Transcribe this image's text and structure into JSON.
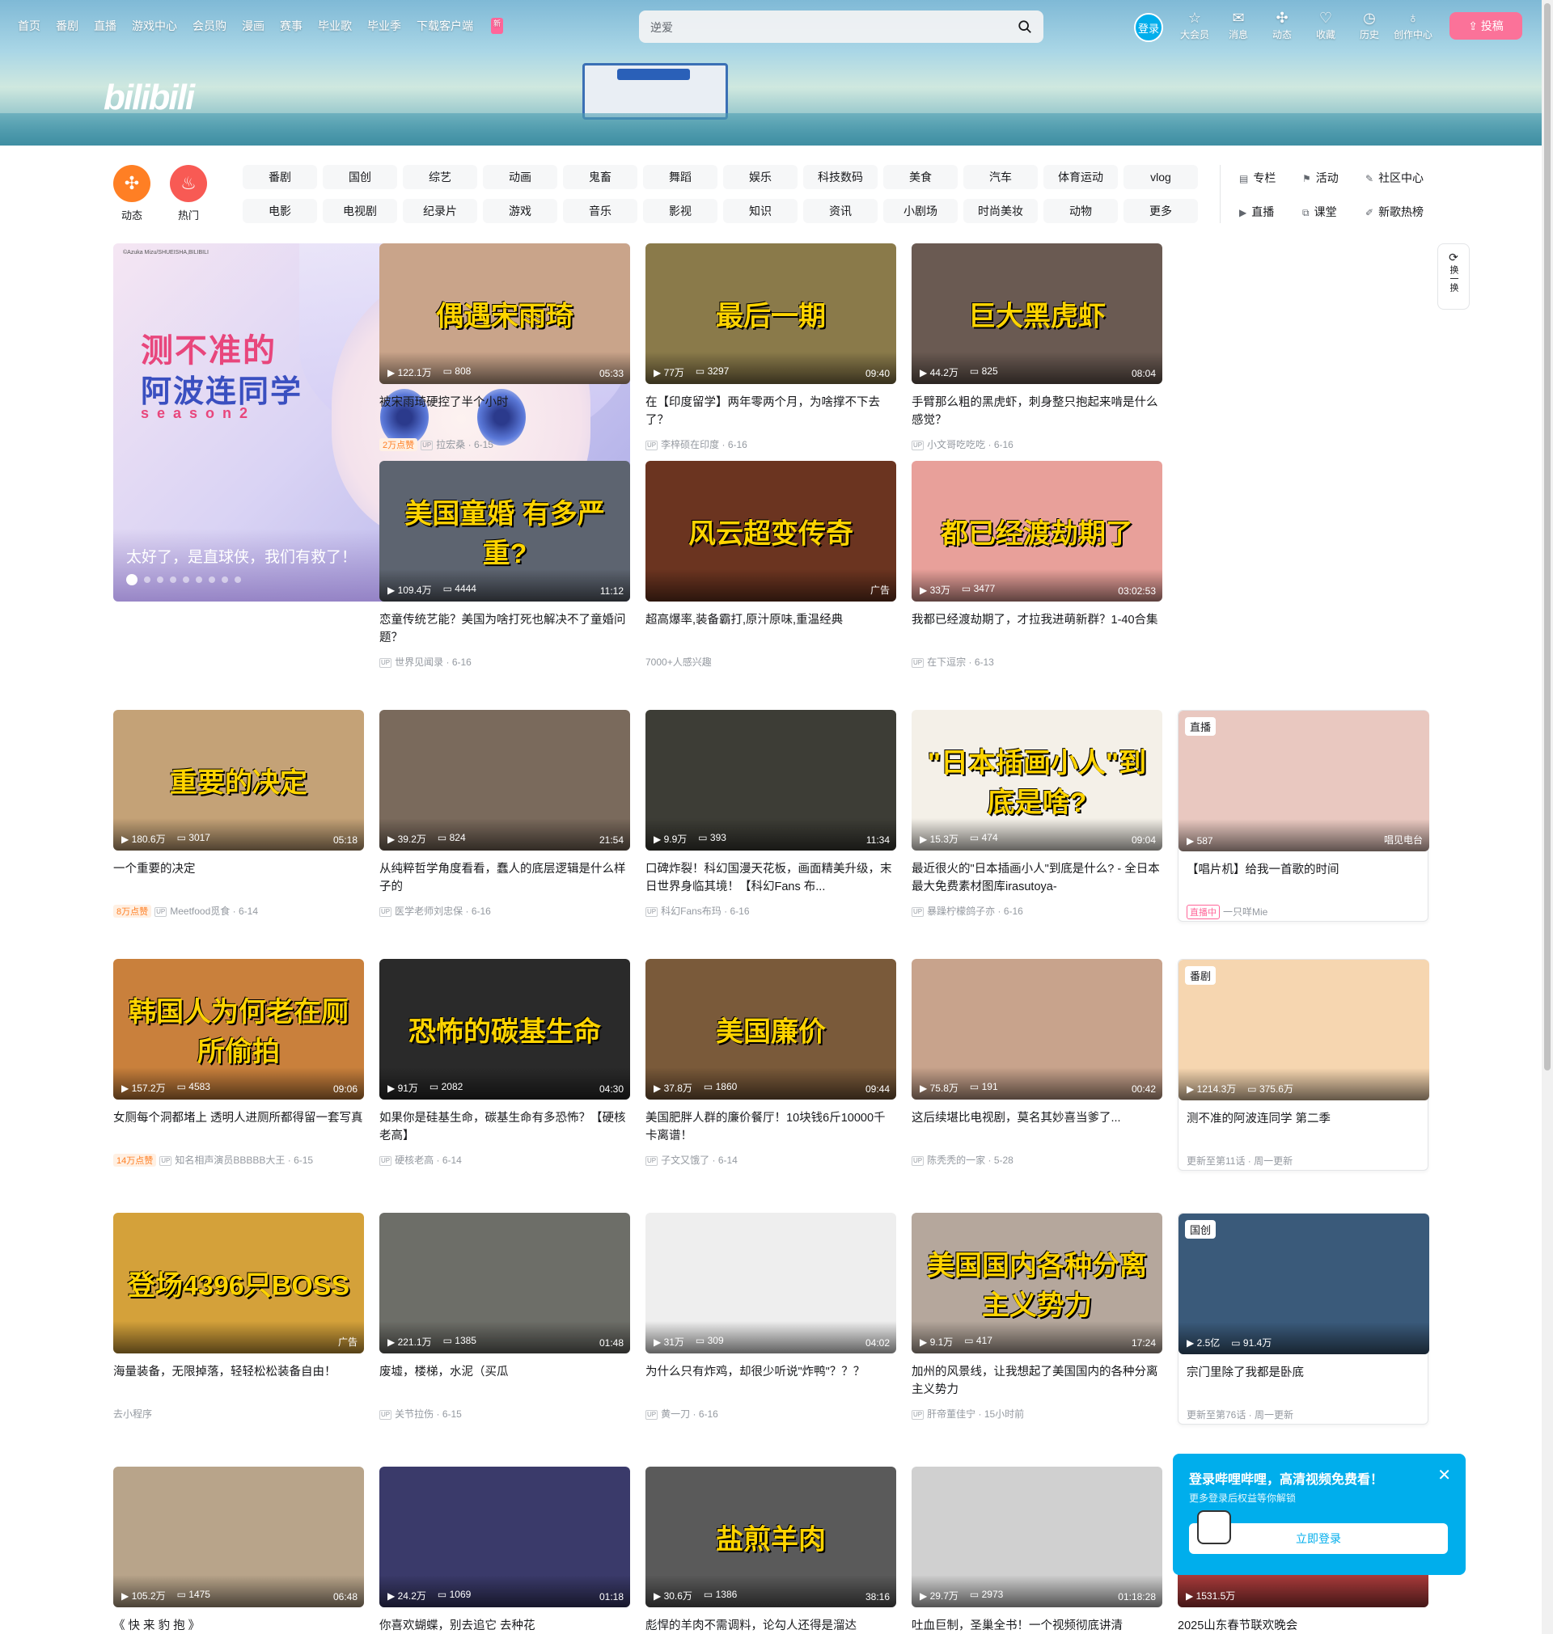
{
  "topnav": {
    "items": [
      "首页",
      "番剧",
      "直播",
      "游戏中心",
      "会员购",
      "漫画",
      "赛事",
      "毕业歌",
      "毕业季",
      "下载客户端"
    ],
    "new_badge": "新",
    "search_placeholder": "逆爱",
    "login": "登录",
    "icons": [
      {
        "label": "大会员",
        "icon": "vip-icon"
      },
      {
        "label": "消息",
        "icon": "message-icon"
      },
      {
        "label": "动态",
        "icon": "dynamic-icon"
      },
      {
        "label": "收藏",
        "icon": "favorite-icon"
      },
      {
        "label": "历史",
        "icon": "history-icon"
      },
      {
        "label": "创作中心",
        "icon": "creator-icon"
      }
    ],
    "upload": "投稿"
  },
  "banner": {
    "logo": "bilibili"
  },
  "channels": {
    "round": [
      {
        "label": "动态",
        "color": "#ff7f24"
      },
      {
        "label": "热门",
        "color": "#f85a54"
      }
    ],
    "grid": [
      "番剧",
      "国创",
      "综艺",
      "动画",
      "鬼畜",
      "舞蹈",
      "娱乐",
      "科技数码",
      "美食",
      "汽车",
      "体育运动",
      "vlog",
      "电影",
      "电视剧",
      "纪录片",
      "游戏",
      "音乐",
      "影视",
      "知识",
      "资讯",
      "小剧场",
      "时尚美妆",
      "动物",
      "更多"
    ],
    "side": [
      "专栏",
      "活动",
      "社区中心",
      "直播",
      "课堂",
      "新歌热榜"
    ]
  },
  "carousel": {
    "credit": "©Azuka Mizu/SHUEISHA,BILIBILI",
    "title_line1": "测不准的",
    "title_line2": "阿波连同学",
    "title_line3": "season2",
    "caption": "太好了，是直球侠，我们有救了！"
  },
  "refresh": {
    "label": "换一换"
  },
  "cards": [
    {
      "thumb_text": "偶遇宋雨琦",
      "views": "122.1万",
      "danmaku": "808",
      "duration": "05:33",
      "title": "被宋雨琦硬控了半个小时",
      "hot": "2万点赞",
      "author": "拉宏桑",
      "date": "6-15",
      "bg": "#c9a48a"
    },
    {
      "thumb_text": "最后一期",
      "views": "77万",
      "danmaku": "3297",
      "duration": "09:40",
      "title": "在【印度留学】两年零两个月，为啥撑不下去了？",
      "author": "李梓硕在印度",
      "date": "6-16",
      "bg": "#8a7a4a"
    },
    {
      "thumb_text": "巨大黑虎虾",
      "views": "44.2万",
      "danmaku": "825",
      "duration": "08:04",
      "title": "手臂那么粗的黑虎虾，刺身整只抱起来啃是什么感觉？",
      "author": "小文哥吃吃吃",
      "date": "6-16",
      "bg": "#6a5a52"
    },
    {
      "thumb_text": "美国童婚 有多严重?",
      "views": "109.4万",
      "danmaku": "4444",
      "duration": "11:12",
      "title": "恋童传统艺能？美国为啥打死也解决不了童婚问题？",
      "author": "世界见闻录",
      "date": "6-16",
      "bg": "#5d6470"
    },
    {
      "thumb_text": "风云超变传奇",
      "views": "",
      "danmaku": "",
      "duration": "广告",
      "title": "超高爆率,装备霸打,原汁原味,重温经典",
      "author": "7000+人感兴趣",
      "date": "",
      "bg": "#6b3420",
      "ad": true
    },
    {
      "thumb_text": "都已经渡劫期了",
      "views": "33万",
      "danmaku": "3477",
      "duration": "03:02:53",
      "title": "我都已经渡劫期了，才拉我进萌新群？1-40合集",
      "author": "在下逗宗",
      "date": "6-13",
      "bg": "#e8a09a"
    },
    {
      "thumb_text": "重要的决定",
      "views": "180.6万",
      "danmaku": "3017",
      "duration": "05:18",
      "title": "一个重要的决定",
      "hot": "8万点赞",
      "author": "Meetfood觅食",
      "date": "6-14",
      "bg": "#c4a277"
    },
    {
      "thumb_text": "",
      "views": "39.2万",
      "danmaku": "824",
      "duration": "21:54",
      "title": "从纯粹哲学角度看看，蠢人的底层逻辑是什么样子的",
      "author": "医学老师刘忠保",
      "date": "6-16",
      "bg": "#7a6a5c"
    },
    {
      "thumb_text": "",
      "views": "9.9万",
      "danmaku": "393",
      "duration": "11:34",
      "title": "口碑炸裂！科幻国漫天花板，画面精美升级，末日世界身临其境！【科幻Fans 布...",
      "author": "科幻Fans布玛",
      "date": "6-16",
      "bg": "#3d3d36"
    },
    {
      "thumb_text": "\"日本插画小人\"到底是啥?",
      "views": "15.3万",
      "danmaku": "474",
      "duration": "09:04",
      "title": "最近很火的\"日本插画小人\"到底是什么? - 全日本最大免费素材图库irasutoya-",
      "author": "暴躁柠檬鸽子亦",
      "date": "6-16",
      "bg": "#f4f0e8"
    },
    {
      "thumb_text": "",
      "live_tag": "直播",
      "views": "587",
      "danmaku": "",
      "duration": "唱见电台",
      "title": "【唱片机】给我一首歌的时间",
      "live_badge": "直播中",
      "author": "一只咩Mie",
      "date": "",
      "bg": "#e9c8c0",
      "framed": true
    },
    {
      "thumb_text": "韩国人为何老在厕所偷拍",
      "views": "157.2万",
      "danmaku": "4583",
      "duration": "09:06",
      "title": "女厕每个洞都堵上 透明人进厕所都得留一套写真",
      "hot": "14万点赞",
      "author": "知名相声演员BBBBB大王",
      "date": "6-15",
      "bg": "#c9803c"
    },
    {
      "thumb_text": "恐怖的碳基生命",
      "views": "91万",
      "danmaku": "2082",
      "duration": "04:30",
      "title": "如果你是硅基生命，碳基生命有多恐怖？【硬核老高】",
      "author": "硬核老高",
      "date": "6-14",
      "bg": "#2a2a2a"
    },
    {
      "thumb_text": "美国廉价",
      "views": "37.8万",
      "danmaku": "1860",
      "duration": "09:44",
      "title": "美国肥胖人群的廉价餐厅！10块钱6斤10000千卡离谱！",
      "author": "子文又饿了",
      "date": "6-14",
      "bg": "#7a5a3a"
    },
    {
      "thumb_text": "",
      "views": "75.8万",
      "danmaku": "191",
      "duration": "00:42",
      "title": "这后续堪比电视剧，莫名其妙喜当爹了...",
      "author": "陈秃秃的一家",
      "date": "5-28",
      "bg": "#c8a38c"
    },
    {
      "thumb_text": "",
      "anime_tag": "番剧",
      "views": "1214.3万",
      "danmaku": "375.6万",
      "duration": "",
      "title": "测不准的阿波连同学 第二季",
      "author": "更新至第11话 · 周一更新",
      "date": "",
      "bg": "#f6d6b0",
      "framed": true
    },
    {
      "thumb_text": "登场4396只BOSS",
      "views": "",
      "danmaku": "",
      "duration": "广告",
      "title": "海量装备，无限掉落，轻轻松松装备自由！",
      "author": "去小程序",
      "date": "",
      "bg": "#d4a13a",
      "ad": true
    },
    {
      "thumb_text": "",
      "views": "221.1万",
      "danmaku": "1385",
      "duration": "01:48",
      "title": "废墟，楼梯，水泥（买瓜",
      "author": "关节拉伤",
      "date": "6-15",
      "bg": "#6d6e68"
    },
    {
      "thumb_text": "",
      "views": "31万",
      "danmaku": "309",
      "duration": "04:02",
      "title": "为什么只有炸鸡，却很少听说\"炸鸭\"？？？",
      "author": "黄一刀",
      "date": "6-16",
      "bg": "#eeeeee"
    },
    {
      "thumb_text": "美国国内各种分离主义势力",
      "views": "9.1万",
      "danmaku": "417",
      "duration": "17:24",
      "title": "加州的风景线，让我想起了美国国内的各种分离主义势力",
      "author": "肝帝董佳宁",
      "date": "15小时前",
      "bg": "#b5a79c"
    },
    {
      "thumb_text": "",
      "anime_tag": "国创",
      "views": "2.5亿",
      "danmaku": "91.4万",
      "duration": "",
      "title": "宗门里除了我都是卧底",
      "author": "更新至第76话 · 周一更新",
      "date": "",
      "bg": "#3a5a7a",
      "framed": true
    },
    {
      "thumb_text": "",
      "views": "105.2万",
      "danmaku": "1475",
      "duration": "06:48",
      "title": "《 快 来 豹 抱 》",
      "author": "",
      "date": "",
      "bg": "#b8a48a"
    },
    {
      "thumb_text": "",
      "views": "24.2万",
      "danmaku": "1069",
      "duration": "01:18",
      "title": "你喜欢蝴蝶，别去追它 去种花",
      "author": "",
      "date": "",
      "bg": "#3a3a6a"
    },
    {
      "thumb_text": "盐煎羊肉",
      "views": "30.6万",
      "danmaku": "1386",
      "duration": "38:16",
      "title": "彪悍的羊肉不需调料，论勾人还得是溜达",
      "author": "",
      "date": "",
      "bg": "#5a5a5a"
    },
    {
      "thumb_text": "",
      "views": "29.7万",
      "danmaku": "2973",
      "duration": "01:18:28",
      "title": "吐血巨制，圣巢全书！一个视频彻底讲清",
      "author": "",
      "date": "",
      "bg": "#d0d0d0"
    },
    {
      "thumb_text": "",
      "views": "1531.5万",
      "danmaku": "",
      "duration": "",
      "title": "2025山东春节联欢晚会",
      "author": "",
      "date": "",
      "bg": "#a83a3a"
    }
  ],
  "toast": {
    "heading": "登录哔哩哔哩，高清视频免费看！",
    "sub": "更多登录后权益等你解锁",
    "button": "立即登录"
  }
}
